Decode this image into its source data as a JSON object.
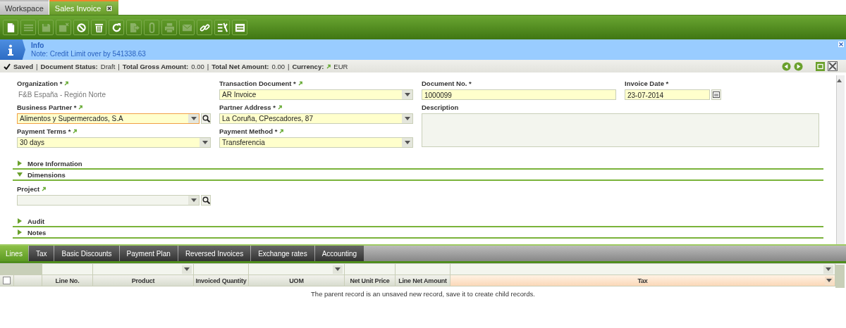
{
  "tabs": [
    {
      "label": "Workspace",
      "selected": false,
      "closable": false
    },
    {
      "label": "Sales Invoice",
      "selected": true,
      "closable": true
    }
  ],
  "toolbar": [
    {
      "kind": "new",
      "disabled": false
    },
    {
      "kind": "grid",
      "disabled": true
    },
    {
      "kind": "save",
      "disabled": true
    },
    {
      "kind": "save-close",
      "disabled": true
    },
    {
      "kind": "undo",
      "disabled": false
    },
    {
      "kind": "delete",
      "disabled": false
    },
    {
      "kind": "refresh",
      "disabled": false
    },
    {
      "kind": "export",
      "disabled": true
    },
    {
      "kind": "attach",
      "disabled": true
    },
    {
      "kind": "print",
      "disabled": true
    },
    {
      "kind": "email",
      "disabled": true
    },
    {
      "kind": "link",
      "disabled": false
    },
    {
      "kind": "tools",
      "disabled": false
    },
    {
      "kind": "form",
      "disabled": false
    }
  ],
  "message": {
    "title": "Info",
    "text": "Note: Credit Limit over by 541338.63"
  },
  "status": {
    "saved": "Saved",
    "separator": "|",
    "items": [
      {
        "label": "Document Status:",
        "value": "Draft",
        "linked": false
      },
      {
        "label": "Total Gross Amount:",
        "value": "0.00",
        "linked": false
      },
      {
        "label": "Total Net Amount:",
        "value": "0.00",
        "linked": false
      },
      {
        "label": "Currency:",
        "value": "EUR",
        "linked": true
      }
    ]
  },
  "fields": [
    {
      "kind": "display",
      "label": "Organization *",
      "linked": true,
      "value": "F&B España - Región Norte"
    },
    {
      "kind": "combo",
      "label": "Transaction Document *",
      "linked": true,
      "required": true,
      "value": "AR Invoice"
    },
    {
      "kind": "text",
      "label": "Document No. *",
      "linked": false,
      "required": true,
      "value": "1000099"
    },
    {
      "kind": "date",
      "label": "Invoice Date *",
      "linked": false,
      "required": true,
      "value": "23-07-2014"
    },
    {
      "kind": "combo-search",
      "label": "Business Partner *",
      "linked": true,
      "required": true,
      "focused": true,
      "value": "Alimentos y Supermercados, S.A"
    },
    {
      "kind": "combo",
      "label": "Partner Address *",
      "linked": true,
      "required": true,
      "value": "La Coruña, CPescadores, 87"
    },
    {
      "kind": "textarea",
      "label": "Description",
      "linked": false,
      "required": false
    },
    {
      "kind": "combo",
      "label": "Payment Terms *",
      "linked": true,
      "required": true,
      "value": "30 days"
    },
    {
      "kind": "combo",
      "label": "Payment Method *",
      "linked": true,
      "required": true,
      "value": "Transferencia"
    }
  ],
  "sections": [
    {
      "label": "More Information",
      "expanded": false
    },
    {
      "label": "Dimensions",
      "expanded": true,
      "fields": [
        {
          "kind": "combo-search",
          "label": "Project",
          "linked": true,
          "required": false
        }
      ]
    },
    {
      "label": "Audit",
      "expanded": false
    },
    {
      "label": "Notes",
      "expanded": false
    }
  ],
  "subtabs": [
    {
      "label": "Lines",
      "selected": true
    },
    {
      "label": "Tax",
      "selected": false
    },
    {
      "label": "Basic Discounts",
      "selected": false
    },
    {
      "label": "Payment Plan",
      "selected": false
    },
    {
      "label": "Reversed Invoices",
      "selected": false
    },
    {
      "label": "Exchange rates",
      "selected": false
    },
    {
      "label": "Accounting",
      "selected": false
    }
  ],
  "grid": {
    "columns": [
      {
        "kind": "checkbox",
        "checked": false
      },
      {
        "kind": "blank"
      },
      {
        "kind": "data",
        "label": "Line No.",
        "filter_dropdown": false,
        "selected": false
      },
      {
        "kind": "data",
        "label": "Product",
        "filter_dropdown": true,
        "selected": false
      },
      {
        "kind": "data",
        "label": "Invoiced Quantity",
        "filter_dropdown": false,
        "selected": false
      },
      {
        "kind": "data",
        "label": "UOM",
        "filter_dropdown": true,
        "selected": false
      },
      {
        "kind": "data",
        "label": "Net Unit Price",
        "filter_dropdown": false,
        "selected": false
      },
      {
        "kind": "data",
        "label": "Line Net Amount",
        "filter_dropdown": false,
        "selected": false
      },
      {
        "kind": "data",
        "label": "Tax",
        "filter_dropdown": true,
        "selected": true
      }
    ],
    "message": "The parent record is an unsaved new record, save it to create child records."
  }
}
